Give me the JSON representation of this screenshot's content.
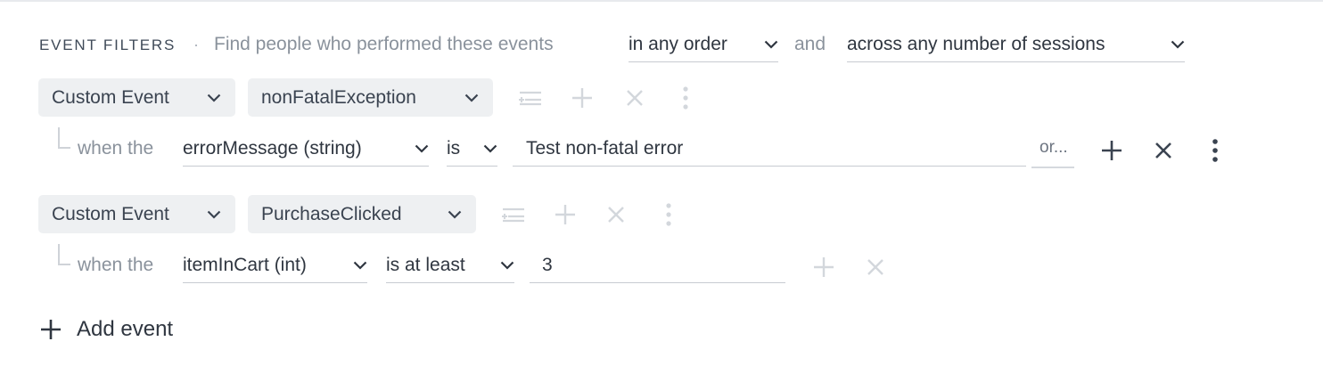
{
  "header": {
    "title": "EVENT FILTERS",
    "separator": "·",
    "description": "Find people who performed these events",
    "order_select": "in any order",
    "conjunction": "and",
    "sessions_select": "across any number of sessions"
  },
  "events": [
    {
      "type_label": "Custom Event",
      "event_name": "nonFatalException",
      "condition": {
        "when_label": "when the",
        "property": "errorMessage (string)",
        "operator": "is",
        "value": "Test non-fatal error",
        "or_label": "or..."
      }
    },
    {
      "type_label": "Custom Event",
      "event_name": "PurchaseClicked",
      "condition": {
        "when_label": "when the",
        "property": "itemInCart (int)",
        "operator": "is at least",
        "value": "3"
      }
    }
  ],
  "add_event_label": "Add event",
  "colors": {
    "chip_bg": "#eef0f2",
    "text": "#2f3640",
    "muted": "#8a929c",
    "disabled_icon": "#d3d7dc",
    "active_icon": "#3a4350"
  },
  "icons": [
    "chevron-down-icon",
    "filter-add-icon",
    "plus-icon",
    "close-icon",
    "more-vertical-icon"
  ]
}
